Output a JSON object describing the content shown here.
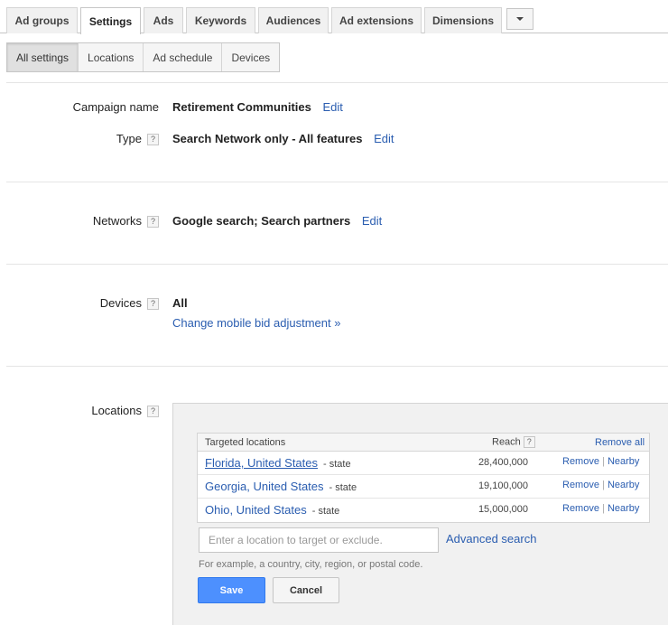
{
  "tabs": [
    {
      "label": "Ad groups"
    },
    {
      "label": "Settings"
    },
    {
      "label": "Ads"
    },
    {
      "label": "Keywords"
    },
    {
      "label": "Audiences"
    },
    {
      "label": "Ad extensions"
    },
    {
      "label": "Dimensions"
    }
  ],
  "subtabs": [
    {
      "label": "All settings"
    },
    {
      "label": "Locations"
    },
    {
      "label": "Ad schedule"
    },
    {
      "label": "Devices"
    }
  ],
  "settings": {
    "campaign_name": {
      "label": "Campaign name",
      "value": "Retirement Communities",
      "edit": "Edit"
    },
    "type": {
      "label": "Type",
      "help": "?",
      "value": "Search Network only - All features",
      "edit": "Edit"
    },
    "networks": {
      "label": "Networks",
      "help": "?",
      "value": "Google search; Search partners",
      "edit": "Edit"
    },
    "devices": {
      "label": "Devices",
      "help": "?",
      "value": "All",
      "link": "Change mobile bid adjustment »"
    },
    "locations": {
      "label": "Locations",
      "help": "?"
    }
  },
  "locations_table": {
    "header_targeted": "Targeted locations",
    "header_reach": "Reach",
    "header_help": "?",
    "remove_all": "Remove all",
    "rows": [
      {
        "name": "Florida, United States",
        "type": "- state",
        "reach": "28,400,000",
        "remove": "Remove",
        "sep": "|",
        "nearby": "Nearby"
      },
      {
        "name": "Georgia, United States",
        "type": "- state",
        "reach": "19,100,000",
        "remove": "Remove",
        "sep": "|",
        "nearby": "Nearby"
      },
      {
        "name": "Ohio, United States",
        "type": "- state",
        "reach": "15,000,000",
        "remove": "Remove",
        "sep": "|",
        "nearby": "Nearby"
      }
    ]
  },
  "location_search": {
    "placeholder": "Enter a location to target or exclude.",
    "advanced": "Advanced search",
    "hint": "For example, a country, city, region, or postal code."
  },
  "buttons": {
    "save": "Save",
    "cancel": "Cancel"
  },
  "colors": {
    "link": "#2a5db0",
    "save_button": "#4d90fe"
  }
}
